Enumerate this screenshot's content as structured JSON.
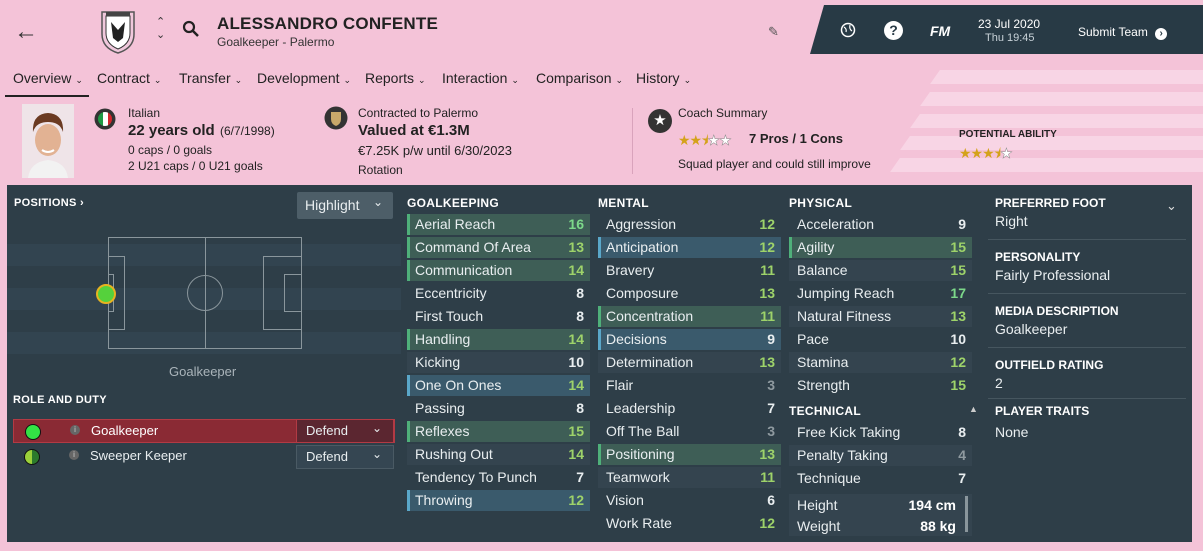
{
  "header": {
    "player_name": "ALESSANDRO CONFENTE",
    "subtitle": "Goalkeeper - Palermo",
    "back_icon": "arrow-left-icon",
    "date": "23 Jul 2020",
    "time": "Thu 19:45",
    "fm_label": "FM",
    "help_label": "?",
    "submit_label": "Submit Team"
  },
  "nav": {
    "items": [
      "Overview",
      "Contract",
      "Transfer",
      "Development",
      "Reports",
      "Interaction",
      "Comparison",
      "History"
    ],
    "active": "Overview"
  },
  "info": {
    "nationality": "Italian",
    "age": "22 years old",
    "dob": "(6/7/1998)",
    "caps": "0 caps / 0 goals",
    "u21caps": "2 U21 caps / 0 U21 goals",
    "contracted": "Contracted to Palermo",
    "value": "Valued at €1.3M",
    "wage": "€7.25K p/w until 6/30/2023",
    "squad_status": "Rotation",
    "coach_title": "Coach Summary",
    "pros_cons": "7 Pros / 1 Cons",
    "coach_desc": "Squad player and could still improve",
    "potential_label": "POTENTIAL ABILITY",
    "current_stars": 2.5,
    "potential_stars": 3.5
  },
  "left": {
    "positions_label": "POSITIONS ›",
    "highlight_label": "Highlight",
    "position_name": "Goalkeeper",
    "role_duty_label": "ROLE AND DUTY",
    "roles": [
      {
        "name": "Goalkeeper",
        "duty": "Defend"
      },
      {
        "name": "Sweeper Keeper",
        "duty": "Defend"
      }
    ]
  },
  "attributes": {
    "goalkeeping_label": "GOALKEEPING",
    "mental_label": "MENTAL",
    "physical_label": "PHYSICAL",
    "technical_label": "TECHNICAL",
    "goalkeeping": [
      {
        "name": "Aerial Reach",
        "value": "16"
      },
      {
        "name": "Command Of Area",
        "value": "13"
      },
      {
        "name": "Communication",
        "value": "14"
      },
      {
        "name": "Eccentricity",
        "value": "8"
      },
      {
        "name": "First Touch",
        "value": "8"
      },
      {
        "name": "Handling",
        "value": "14"
      },
      {
        "name": "Kicking",
        "value": "10"
      },
      {
        "name": "One On Ones",
        "value": "14"
      },
      {
        "name": "Passing",
        "value": "8"
      },
      {
        "name": "Reflexes",
        "value": "15"
      },
      {
        "name": "Rushing Out",
        "value": "14"
      },
      {
        "name": "Tendency To Punch",
        "value": "7"
      },
      {
        "name": "Throwing",
        "value": "12"
      }
    ],
    "mental": [
      {
        "name": "Aggression",
        "value": "12"
      },
      {
        "name": "Anticipation",
        "value": "12"
      },
      {
        "name": "Bravery",
        "value": "11"
      },
      {
        "name": "Composure",
        "value": "13"
      },
      {
        "name": "Concentration",
        "value": "11"
      },
      {
        "name": "Decisions",
        "value": "9"
      },
      {
        "name": "Determination",
        "value": "13"
      },
      {
        "name": "Flair",
        "value": "3"
      },
      {
        "name": "Leadership",
        "value": "7"
      },
      {
        "name": "Off The Ball",
        "value": "3"
      },
      {
        "name": "Positioning",
        "value": "13"
      },
      {
        "name": "Teamwork",
        "value": "11"
      },
      {
        "name": "Vision",
        "value": "6"
      },
      {
        "name": "Work Rate",
        "value": "12"
      }
    ],
    "physical": [
      {
        "name": "Acceleration",
        "value": "9"
      },
      {
        "name": "Agility",
        "value": "15"
      },
      {
        "name": "Balance",
        "value": "15"
      },
      {
        "name": "Jumping Reach",
        "value": "17"
      },
      {
        "name": "Natural Fitness",
        "value": "13"
      },
      {
        "name": "Pace",
        "value": "10"
      },
      {
        "name": "Stamina",
        "value": "12"
      },
      {
        "name": "Strength",
        "value": "15"
      }
    ],
    "technical": [
      {
        "name": "Free Kick Taking",
        "value": "8"
      },
      {
        "name": "Penalty Taking",
        "value": "4"
      },
      {
        "name": "Technique",
        "value": "7"
      }
    ],
    "height_label": "Height",
    "height": "194 cm",
    "weight_label": "Weight",
    "weight": "88 kg"
  },
  "right": {
    "foot_label": "PREFERRED FOOT",
    "foot": "Right",
    "personality_label": "PERSONALITY",
    "personality": "Fairly Professional",
    "media_label": "MEDIA DESCRIPTION",
    "media": "Goalkeeper",
    "outfield_label": "OUTFIELD RATING",
    "outfield": "2",
    "traits_label": "PLAYER TRAITS",
    "traits": "None"
  }
}
